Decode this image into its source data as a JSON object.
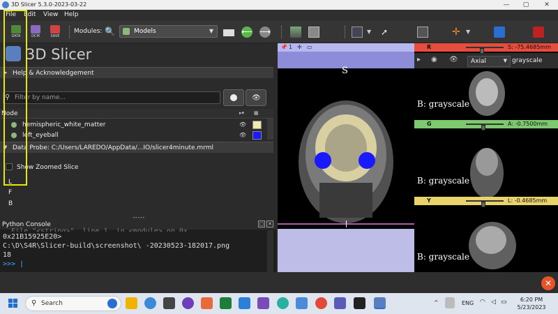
{
  "window": {
    "title": "3D Slicer 5.3.0-2023-03-22",
    "minimize": "—",
    "maximize": "▢",
    "close": "✕"
  },
  "menubar": {
    "items": [
      "File",
      "Edit",
      "View",
      "Help"
    ]
  },
  "toolbar": {
    "data_label": "DATA",
    "dcm_label": "DCM",
    "save_label": "SAVE",
    "modules_label": "Modules:",
    "module_selected": "Models"
  },
  "panel": {
    "app_name": "3D Slicer",
    "help_section": "Help & Acknowledgement",
    "filter_placeholder": "Filter by name...",
    "tree_header": "Node",
    "nodes": [
      {
        "name": "hemispheric_white_matter",
        "color": "#f0eab0"
      },
      {
        "name": "left_eyeball",
        "color": "#1a1aff"
      }
    ],
    "probe_section": "Data Probe: C:/Users/LAREDO/AppData/...IO/slicer4minute.mrml",
    "show_zoomed": "Show Zoomed Slice",
    "probe_l": "L",
    "probe_f": "F",
    "probe_b": "B"
  },
  "console": {
    "title": "Python Console",
    "lines": [
      "0x21B15925E20>",
      "C:\\D\\S4R\\Slicer-build\\screenshot\\ -20230523-182017.png",
      "18"
    ],
    "prompt": ">>> |",
    "partial_line": "  File \"<string>\", line 1, in <module> on 0x..."
  },
  "views": {
    "mid_letter": "S",
    "red": {
      "letter": "R",
      "value": "S: -75.4685mm",
      "color": "#e74c3c"
    },
    "green": {
      "letter": "G",
      "value": "A: -0.7500mm",
      "color": "#7ec870"
    },
    "yellow": {
      "letter": "Y",
      "value": "L: -0.4685mm",
      "color": "#e8d46a"
    },
    "orientation": "Axial",
    "volume": "grayscale",
    "volume_caption": "B: grayscale"
  },
  "taskbar": {
    "search": "Search",
    "lang": "ENG",
    "time": "6:20 PM",
    "date": "5/23/2023"
  }
}
